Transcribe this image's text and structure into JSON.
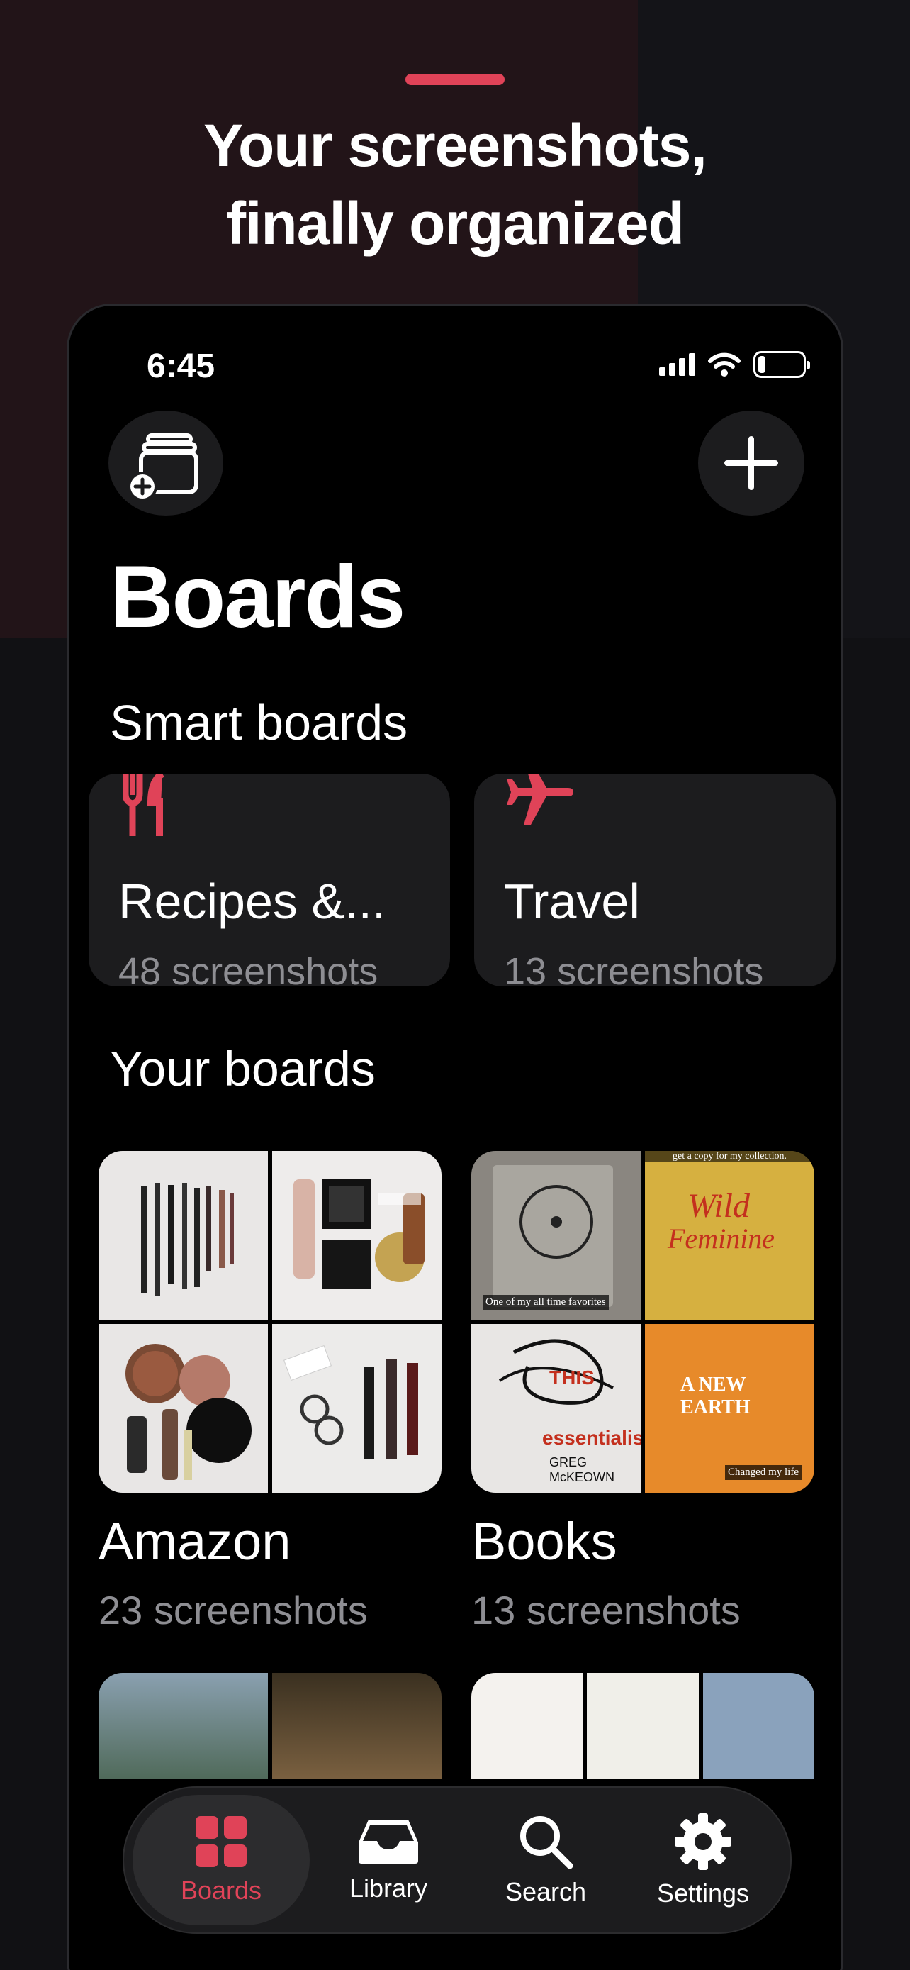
{
  "promo": {
    "headline_line1": "Your screenshots,",
    "headline_line2": "finally organized"
  },
  "status_bar": {
    "time": "6:45"
  },
  "header": {
    "title": "Boards"
  },
  "smart_boards": {
    "title": "Smart boards",
    "items": [
      {
        "title": "Recipes &...",
        "count": "48 screenshots",
        "icon": "fork-knife-icon"
      },
      {
        "title": "Travel",
        "count": "13 screenshots",
        "icon": "airplane-icon"
      }
    ]
  },
  "your_boards": {
    "title": "Your boards",
    "items": [
      {
        "title": "Amazon",
        "count": "23 screenshots"
      },
      {
        "title": "Books",
        "count": "13 screenshots"
      }
    ]
  },
  "book_captions": {
    "top_left": "One of my all time favorites",
    "top_right": "get a copy for my collection.",
    "bottom_right": "Changed my life",
    "wild": "Wild",
    "feminine": "Feminine",
    "this": "THIS",
    "essentialism": "essentialism",
    "mckeown": "GREG McKEOWN",
    "new_earth": "A NEW EARTH"
  },
  "tab_bar": {
    "tabs": [
      {
        "label": "Boards",
        "icon": "grid-icon",
        "active": true
      },
      {
        "label": "Library",
        "icon": "tray-icon",
        "active": false
      },
      {
        "label": "Search",
        "icon": "search-icon",
        "active": false
      },
      {
        "label": "Settings",
        "icon": "gear-icon",
        "active": false
      }
    ]
  },
  "colors": {
    "accent": "#e04358",
    "background": "#000000",
    "card": "#1c1c1e",
    "secondary_text": "#8e8e93"
  }
}
